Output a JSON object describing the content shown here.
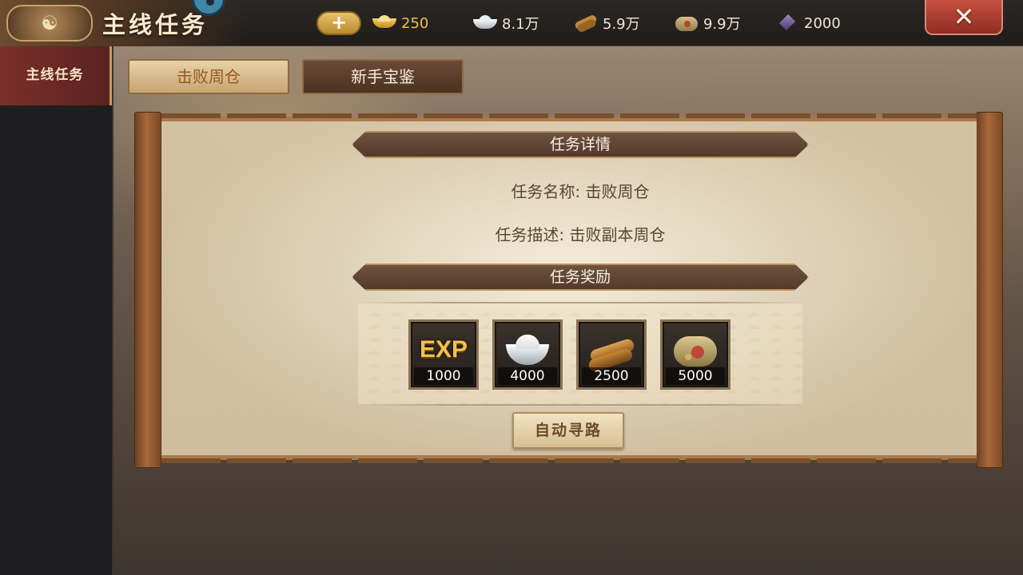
{
  "header": {
    "title": "主线任务",
    "emblem_glyph": "☯",
    "add_label": "+",
    "resources": [
      {
        "name": "gold-ingot",
        "value": "250",
        "color": "#f0c054"
      },
      {
        "name": "silver",
        "value": "8.1万"
      },
      {
        "name": "wood",
        "value": "5.9万"
      },
      {
        "name": "grain",
        "value": "9.9万"
      },
      {
        "name": "gem",
        "value": "2000"
      }
    ],
    "close_label": "✕"
  },
  "sidebar": {
    "items": [
      {
        "label": "主线任务",
        "selected": true
      }
    ]
  },
  "tabs": [
    {
      "label": "击败周仓",
      "active": true
    },
    {
      "label": "新手宝鉴",
      "active": false
    }
  ],
  "panel": {
    "detail_heading": "任务详情",
    "name_label": "任务名称:",
    "name_value": "击败周仓",
    "desc_label": "任务描述:",
    "desc_value": "击败副本周仓",
    "reward_heading": "任务奖励",
    "rewards": [
      {
        "icon": "exp-icon",
        "art_text": "EXP",
        "count": "1000"
      },
      {
        "icon": "silver-ingot-icon",
        "count": "4000"
      },
      {
        "icon": "wood-logs-icon",
        "count": "2500"
      },
      {
        "icon": "grain-sack-icon",
        "count": "5000"
      }
    ],
    "auto_path_label": "自动寻路"
  }
}
